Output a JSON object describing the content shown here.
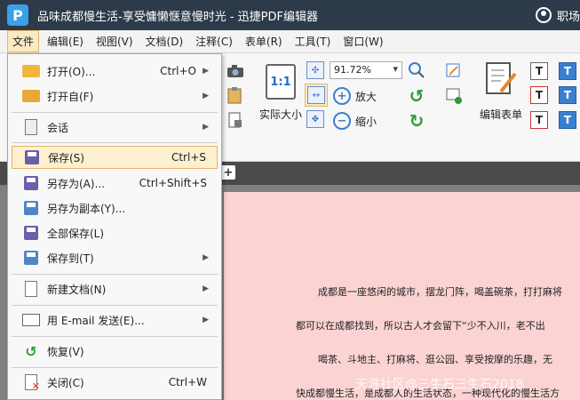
{
  "titlebar": {
    "logo_letter": "P",
    "title": "品味成都慢生活-享受慵懒惬意慢时光  -  迅捷PDF编辑器",
    "user_label": "职场"
  },
  "menubar": {
    "items": [
      "文件",
      "编辑(E)",
      "视图(V)",
      "文档(D)",
      "注释(C)",
      "表单(R)",
      "工具(T)",
      "窗口(W)"
    ]
  },
  "ribbon": {
    "actual_size_icon": "1:1",
    "actual_size_label": "实际大小",
    "zoom_value": "91.72%",
    "zoom_in_label": "放大",
    "zoom_out_label": "缩小",
    "edit_form_label": "编辑表单"
  },
  "file_menu": {
    "items": [
      {
        "label": "打开(O)...",
        "shortcut": "Ctrl+O",
        "submenu": true
      },
      {
        "label": "打开自(F)",
        "shortcut": "",
        "submenu": true
      },
      {
        "label": "会话",
        "shortcut": "",
        "submenu": true
      },
      {
        "label": "保存(S)",
        "shortcut": "Ctrl+S",
        "submenu": false
      },
      {
        "label": "另存为(A)...",
        "shortcut": "Ctrl+Shift+S",
        "submenu": false
      },
      {
        "label": "另存为副本(Y)...",
        "shortcut": "",
        "submenu": false
      },
      {
        "label": "全部保存(L)",
        "shortcut": "",
        "submenu": false
      },
      {
        "label": "保存到(T)",
        "shortcut": "",
        "submenu": true
      },
      {
        "label": "新建文档(N)",
        "shortcut": "",
        "submenu": true
      },
      {
        "label": "用 E-mail 发送(E)...",
        "shortcut": "",
        "submenu": true
      },
      {
        "label": "恢复(V)",
        "shortcut": "",
        "submenu": false
      },
      {
        "label": "关闭(C)",
        "shortcut": "Ctrl+W",
        "submenu": false
      }
    ]
  },
  "document": {
    "lines": [
      "成都是一座悠闲的城市，摆龙门阵，喝盖碗茶，打打麻将",
      "都可以在成都找到，所以古人才会留下“少不入川，老不出",
      "喝茶、斗地主、打麻将、逛公园、享受按摩的乐趣，无",
      "快成都慢生活，是成都人的生活状态，一种现代化的慢生活方"
    ],
    "watermark": "天涯社区@三生石三生石2018"
  },
  "colors": {
    "titlebar_bg": "#2d3a4a",
    "page_bg": "#fbd3d3",
    "highlight": "#fdf0cf"
  }
}
